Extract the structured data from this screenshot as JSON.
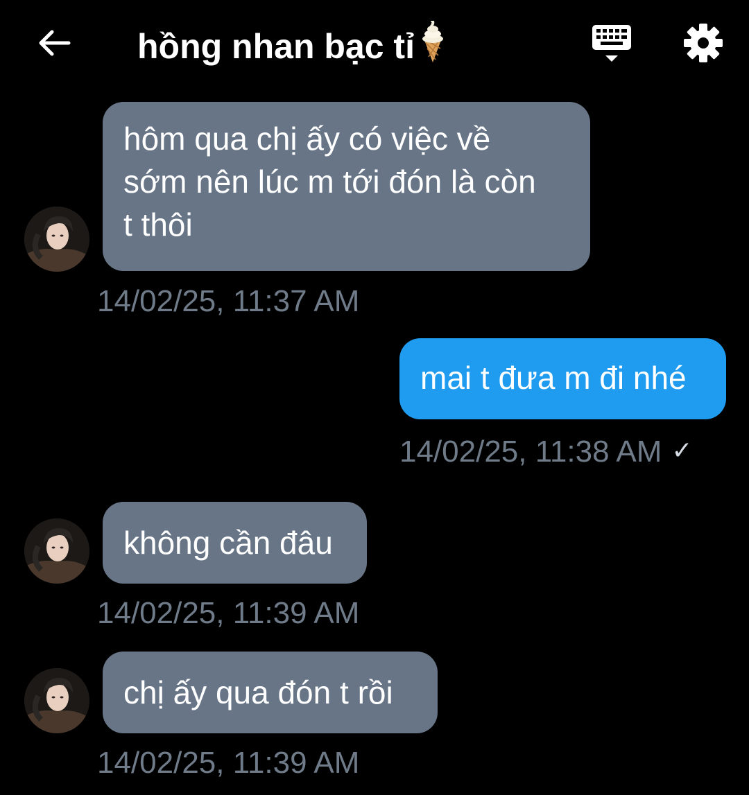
{
  "header": {
    "title": "hồng nhan bạc tỉ",
    "title_emoji": "soft-ice-cream-icon",
    "back_icon": "arrow-left-icon",
    "keyboard_icon": "keyboard-icon",
    "settings_icon": "gear-icon"
  },
  "messages": [
    {
      "direction": "in",
      "text": "hôm qua chị ấy có việc về\nsớm nên lúc m tới đón là còn\nt thôi",
      "time": "14/02/25, 11:37 AM"
    },
    {
      "direction": "out",
      "text": "mai t đưa m đi nhé",
      "time": "14/02/25, 11:38 AM",
      "status": "✓"
    },
    {
      "direction": "in",
      "text": "không cần đâu",
      "time": "14/02/25, 11:39 AM"
    },
    {
      "direction": "in",
      "text": "chị ấy qua đón t rồi",
      "time": "14/02/25, 11:39 AM"
    }
  ],
  "colors": {
    "background": "#000000",
    "incoming_bubble": "#677587",
    "outgoing_bubble": "#1f9cf0",
    "timestamp": "#6f7b89"
  }
}
